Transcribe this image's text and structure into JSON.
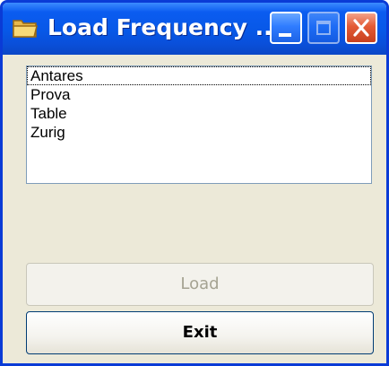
{
  "window": {
    "title": "Load Frequency ...",
    "icons": {
      "app": "folder-icon",
      "minimize": "minimize-icon",
      "maximize": "maximize-icon",
      "close": "close-icon"
    },
    "colors": {
      "titlebar": "#0758e7",
      "close_button": "#e35b35",
      "window_bg": "#ece9d8"
    }
  },
  "list": {
    "items": [
      "Antares",
      "Prova",
      "Table",
      "Zurig"
    ],
    "selected_index": 0
  },
  "buttons": {
    "load_label": "Load",
    "exit_label": "Exit"
  }
}
